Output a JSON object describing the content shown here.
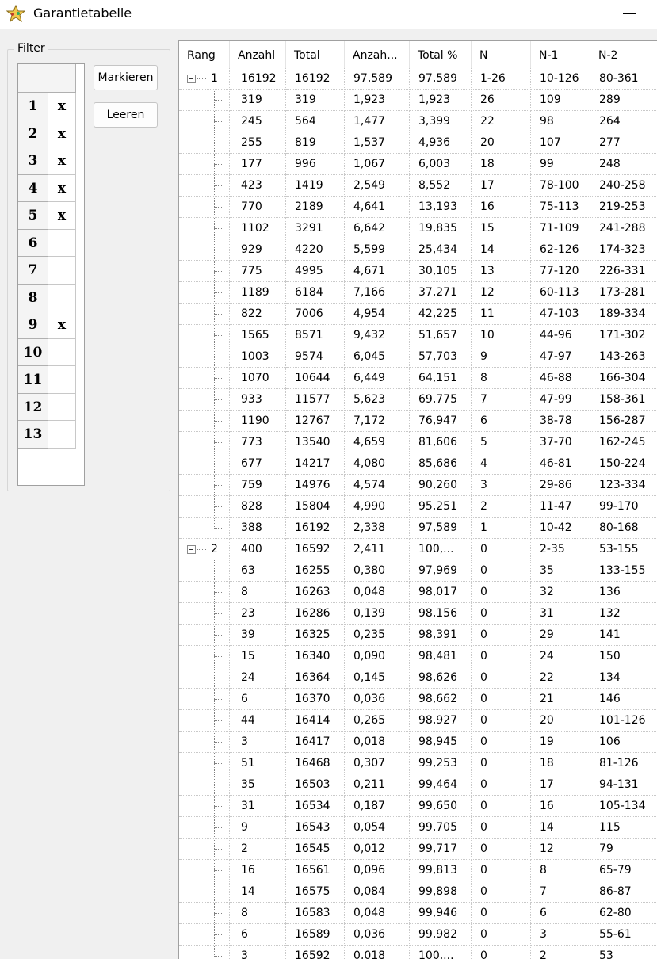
{
  "window": {
    "title": "Garantietabelle"
  },
  "filter": {
    "legend": "Filter",
    "rows": [
      {
        "num": "1",
        "mark": "x"
      },
      {
        "num": "2",
        "mark": "x"
      },
      {
        "num": "3",
        "mark": "x"
      },
      {
        "num": "4",
        "mark": "x"
      },
      {
        "num": "5",
        "mark": "x"
      },
      {
        "num": "6",
        "mark": ""
      },
      {
        "num": "7",
        "mark": ""
      },
      {
        "num": "8",
        "mark": ""
      },
      {
        "num": "9",
        "mark": "x"
      },
      {
        "num": "10",
        "mark": ""
      },
      {
        "num": "11",
        "mark": ""
      },
      {
        "num": "12",
        "mark": ""
      },
      {
        "num": "13",
        "mark": ""
      }
    ]
  },
  "buttons": {
    "mark_label": "Markieren",
    "clear_label": "Leeren"
  },
  "table": {
    "columns": [
      "Rang",
      "Anzahl",
      "Total",
      "Anzah...",
      "Total %",
      "N",
      "N-1",
      "N-2"
    ],
    "rows": [
      {
        "rang": "1",
        "parent": true,
        "cells": [
          "16192",
          "16192",
          "97,589",
          "97,589",
          "1-26",
          "10-126",
          "80-361"
        ]
      },
      {
        "cells": [
          "319",
          "319",
          "1,923",
          "1,923",
          "26",
          "109",
          "289"
        ]
      },
      {
        "cells": [
          "245",
          "564",
          "1,477",
          "3,399",
          "22",
          "98",
          "264"
        ]
      },
      {
        "cells": [
          "255",
          "819",
          "1,537",
          "4,936",
          "20",
          "107",
          "277"
        ]
      },
      {
        "cells": [
          "177",
          "996",
          "1,067",
          "6,003",
          "18",
          "99",
          "248"
        ]
      },
      {
        "cells": [
          "423",
          "1419",
          "2,549",
          "8,552",
          "17",
          "78-100",
          "240-258"
        ]
      },
      {
        "cells": [
          "770",
          "2189",
          "4,641",
          "13,193",
          "16",
          "75-113",
          "219-253"
        ]
      },
      {
        "cells": [
          "1102",
          "3291",
          "6,642",
          "19,835",
          "15",
          "71-109",
          "241-288"
        ]
      },
      {
        "cells": [
          "929",
          "4220",
          "5,599",
          "25,434",
          "14",
          "62-126",
          "174-323"
        ]
      },
      {
        "cells": [
          "775",
          "4995",
          "4,671",
          "30,105",
          "13",
          "77-120",
          "226-331"
        ]
      },
      {
        "cells": [
          "1189",
          "6184",
          "7,166",
          "37,271",
          "12",
          "60-113",
          "173-281"
        ]
      },
      {
        "cells": [
          "822",
          "7006",
          "4,954",
          "42,225",
          "11",
          "47-103",
          "189-334"
        ]
      },
      {
        "cells": [
          "1565",
          "8571",
          "9,432",
          "51,657",
          "10",
          "44-96",
          "171-302"
        ]
      },
      {
        "cells": [
          "1003",
          "9574",
          "6,045",
          "57,703",
          "9",
          "47-97",
          "143-263"
        ]
      },
      {
        "cells": [
          "1070",
          "10644",
          "6,449",
          "64,151",
          "8",
          "46-88",
          "166-304"
        ]
      },
      {
        "cells": [
          "933",
          "11577",
          "5,623",
          "69,775",
          "7",
          "47-99",
          "158-361"
        ]
      },
      {
        "cells": [
          "1190",
          "12767",
          "7,172",
          "76,947",
          "6",
          "38-78",
          "156-287"
        ]
      },
      {
        "cells": [
          "773",
          "13540",
          "4,659",
          "81,606",
          "5",
          "37-70",
          "162-245"
        ]
      },
      {
        "cells": [
          "677",
          "14217",
          "4,080",
          "85,686",
          "4",
          "46-81",
          "150-224"
        ]
      },
      {
        "cells": [
          "759",
          "14976",
          "4,574",
          "90,260",
          "3",
          "29-86",
          "123-334"
        ]
      },
      {
        "cells": [
          "828",
          "15804",
          "4,990",
          "95,251",
          "2",
          "11-47",
          "99-170"
        ]
      },
      {
        "cells": [
          "388",
          "16192",
          "2,338",
          "97,589",
          "1",
          "10-42",
          "80-168"
        ],
        "last": true
      },
      {
        "rang": "2",
        "parent": true,
        "cells": [
          "400",
          "16592",
          "2,411",
          "100,...",
          "0",
          "2-35",
          "53-155"
        ]
      },
      {
        "cells": [
          "63",
          "16255",
          "0,380",
          "97,969",
          "0",
          "35",
          "133-155"
        ]
      },
      {
        "cells": [
          "8",
          "16263",
          "0,048",
          "98,017",
          "0",
          "32",
          "136"
        ]
      },
      {
        "cells": [
          "23",
          "16286",
          "0,139",
          "98,156",
          "0",
          "31",
          "132"
        ]
      },
      {
        "cells": [
          "39",
          "16325",
          "0,235",
          "98,391",
          "0",
          "29",
          "141"
        ]
      },
      {
        "cells": [
          "15",
          "16340",
          "0,090",
          "98,481",
          "0",
          "24",
          "150"
        ]
      },
      {
        "cells": [
          "24",
          "16364",
          "0,145",
          "98,626",
          "0",
          "22",
          "134"
        ]
      },
      {
        "cells": [
          "6",
          "16370",
          "0,036",
          "98,662",
          "0",
          "21",
          "146"
        ]
      },
      {
        "cells": [
          "44",
          "16414",
          "0,265",
          "98,927",
          "0",
          "20",
          "101-126"
        ]
      },
      {
        "cells": [
          "3",
          "16417",
          "0,018",
          "98,945",
          "0",
          "19",
          "106"
        ]
      },
      {
        "cells": [
          "51",
          "16468",
          "0,307",
          "99,253",
          "0",
          "18",
          "81-126"
        ]
      },
      {
        "cells": [
          "35",
          "16503",
          "0,211",
          "99,464",
          "0",
          "17",
          "94-131"
        ]
      },
      {
        "cells": [
          "31",
          "16534",
          "0,187",
          "99,650",
          "0",
          "16",
          "105-134"
        ]
      },
      {
        "cells": [
          "9",
          "16543",
          "0,054",
          "99,705",
          "0",
          "14",
          "115"
        ]
      },
      {
        "cells": [
          "2",
          "16545",
          "0,012",
          "99,717",
          "0",
          "12",
          "79"
        ]
      },
      {
        "cells": [
          "16",
          "16561",
          "0,096",
          "99,813",
          "0",
          "8",
          "65-79"
        ]
      },
      {
        "cells": [
          "14",
          "16575",
          "0,084",
          "99,898",
          "0",
          "7",
          "86-87"
        ]
      },
      {
        "cells": [
          "8",
          "16583",
          "0,048",
          "99,946",
          "0",
          "6",
          "62-80"
        ]
      },
      {
        "cells": [
          "6",
          "16589",
          "0,036",
          "99,982",
          "0",
          "3",
          "55-61"
        ]
      },
      {
        "cells": [
          "3",
          "16592",
          "0,018",
          "100,...",
          "0",
          "2",
          "53"
        ],
        "last": true
      }
    ]
  }
}
